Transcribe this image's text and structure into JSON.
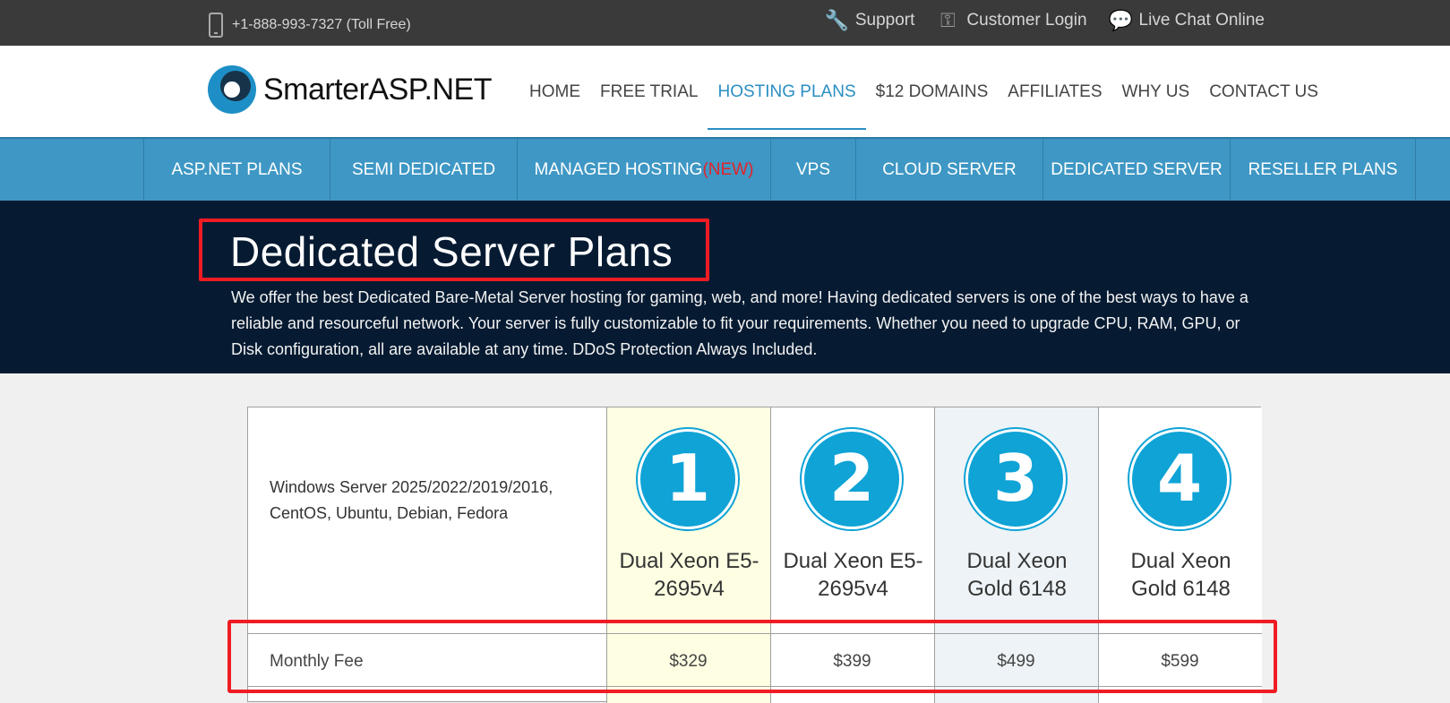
{
  "topbar": {
    "phone": "+1-888-993-7327 (Toll Free)",
    "phone_icon": "phone-icon",
    "links": [
      {
        "label": "Support",
        "icon": "wrench-icon"
      },
      {
        "label": "Customer Login",
        "icon": "key-icon"
      },
      {
        "label": "Live Chat Online",
        "icon": "chat-icon"
      }
    ]
  },
  "header": {
    "logo_text": "SmarterASP.NET",
    "nav": [
      "HOME",
      "FREE TRIAL",
      "HOSTING PLANS",
      "$12 DOMAINS",
      "AFFILIATES",
      "WHY US",
      "CONTACT US"
    ],
    "active": "HOSTING PLANS"
  },
  "subnav": {
    "items": [
      "ASP.NET PLANS",
      "SEMI DEDICATED",
      "MANAGED HOSTING",
      "VPS",
      "CLOUD SERVER",
      "DEDICATED SERVER",
      "RESELLER PLANS"
    ],
    "new_badge": "(NEW)"
  },
  "hero": {
    "title": "Dedicated Server Plans",
    "description": "We offer the best Dedicated Bare-Metal Server hosting for gaming, web, and more! Having dedicated servers is one of the best ways to have a reliable and resourceful network. Your server is fully customizable to fit your requirements. Whether you need to upgrade CPU, RAM, GPU, or Disk configuration, all are available at any time. DDoS Protection Always Included."
  },
  "plans": {
    "os_line1": "Windows Server 2025/2022/2019/2016,",
    "os_line2": "CentOS, Ubuntu, Debian, Fedora",
    "fee_label": "Monthly Fee",
    "columns": [
      {
        "number": "1",
        "cpu_line1": "Dual Xeon E5-",
        "cpu_line2": "2695v4",
        "fee": "$329"
      },
      {
        "number": "2",
        "cpu_line1": "Dual Xeon E5-",
        "cpu_line2": "2695v4",
        "fee": "$399"
      },
      {
        "number": "3",
        "cpu_line1": "Dual Xeon",
        "cpu_line2": "Gold 6148",
        "fee": "$499"
      },
      {
        "number": "4",
        "cpu_line1": "Dual Xeon",
        "cpu_line2": "Gold 6148",
        "fee": "$599"
      }
    ]
  },
  "colors": {
    "accent": "#3e97c4",
    "hero_bg": "#061b32",
    "highlight_red": "#ef1c24",
    "badge_blue": "#0fa3d6"
  }
}
